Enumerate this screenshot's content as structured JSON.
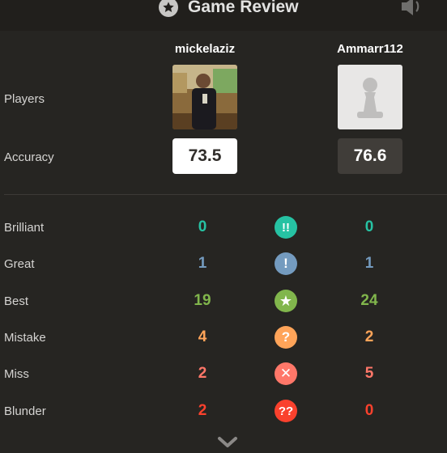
{
  "header": {
    "title": "Game Review"
  },
  "players": {
    "row_label": "Players",
    "accuracy_label": "Accuracy",
    "white": {
      "name": "mickelaziz",
      "accuracy": "73.5"
    },
    "black": {
      "name": "Ammarr112",
      "accuracy": "76.6"
    }
  },
  "stats": [
    {
      "label": "Brilliant",
      "white": "0",
      "black": "0",
      "icon": "brilliant-icon",
      "symbol": "!!",
      "color": "#26c2a3"
    },
    {
      "label": "Great",
      "white": "1",
      "black": "1",
      "icon": "great-icon",
      "symbol": "!",
      "color": "#749bbf"
    },
    {
      "label": "Best",
      "white": "19",
      "black": "24",
      "icon": "best-icon",
      "symbol": "★",
      "color": "#81b64c"
    },
    {
      "label": "Mistake",
      "white": "4",
      "black": "2",
      "icon": "mistake-icon",
      "symbol": "?",
      "color": "#ffa459"
    },
    {
      "label": "Miss",
      "white": "2",
      "black": "5",
      "icon": "miss-icon",
      "symbol": "✕",
      "color": "#ff7769"
    },
    {
      "label": "Blunder",
      "white": "2",
      "black": "0",
      "icon": "blunder-icon",
      "symbol": "??",
      "color": "#fa412d"
    }
  ]
}
